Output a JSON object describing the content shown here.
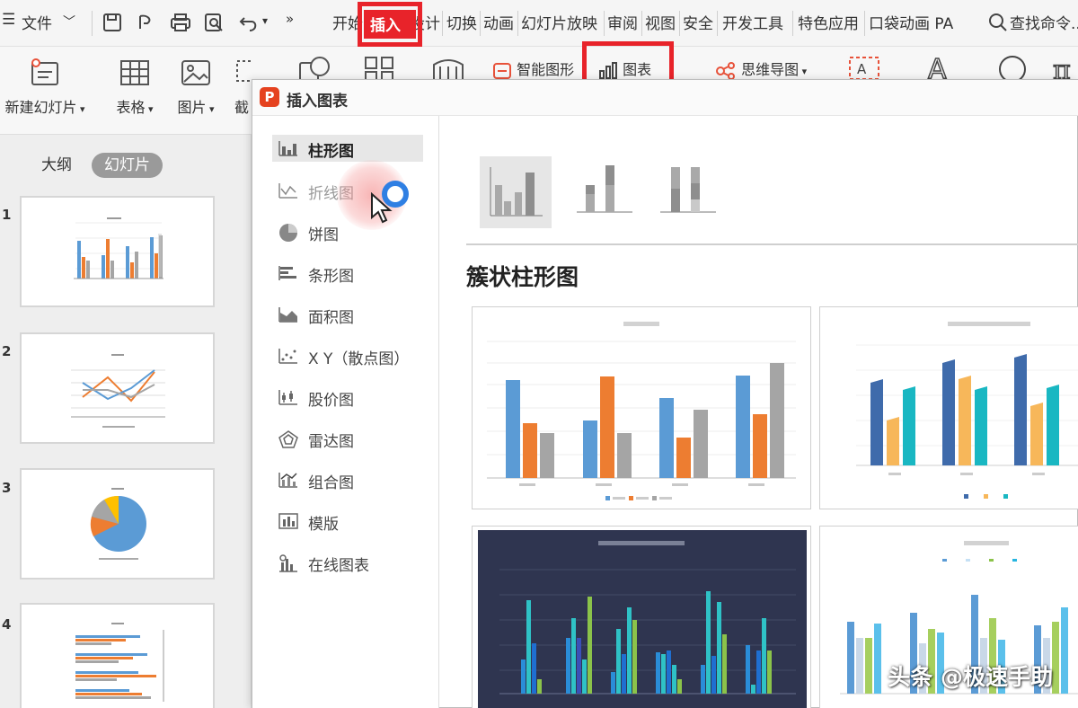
{
  "menubar": {
    "file_label": "文件",
    "tabs": [
      "开始",
      "插入",
      "设计",
      "切换",
      "动画",
      "幻灯片放映",
      "审阅",
      "视图",
      "安全",
      "开发工具",
      "特色应用",
      "口袋动画 PA"
    ],
    "search_label": "查找命令..."
  },
  "ribbon": {
    "new_slide": "新建幻灯片",
    "table": "表格",
    "picture": "图片",
    "screenshot": "截",
    "smartart": "智能图形",
    "chart": "图表",
    "mindmap": "思维导图"
  },
  "leftpanel": {
    "tab_outline": "大纲",
    "tab_slides": "幻灯片",
    "slide_numbers": [
      "1",
      "2",
      "3",
      "4"
    ]
  },
  "dialog": {
    "title": "插入图表",
    "logo_letter": "P",
    "categories": [
      "柱形图",
      "折线图",
      "饼图",
      "条形图",
      "面积图",
      "X Y（散点图）",
      "股价图",
      "雷达图",
      "组合图",
      "模版",
      "在线图表"
    ],
    "selected_category": "柱形图",
    "section_title": "簇状柱形图"
  },
  "colors": {
    "highlight": "#e8232a",
    "accent_blue": "#5b9bd5",
    "accent_orange": "#ed7d31",
    "accent_gray": "#a5a5a5",
    "dark_card_bg": "#2f3550"
  },
  "watermark": "头条 @极速手助"
}
